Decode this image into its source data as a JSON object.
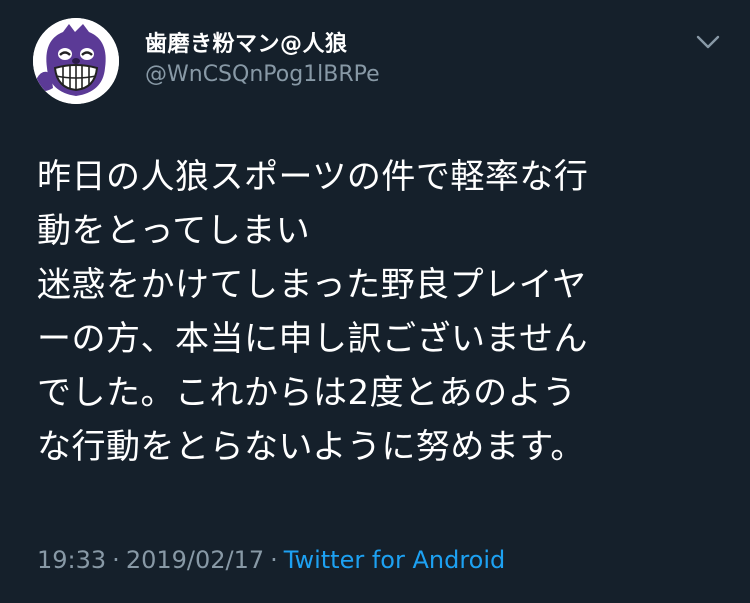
{
  "header": {
    "display_name": "歯磨き粉マン@人狼",
    "handle": "@WnCSQnPog1lBRPe"
  },
  "icons": {
    "avatar": "toothpaste-mascot-avatar",
    "menu": "chevron-down-icon"
  },
  "tweet": {
    "lines": [
      "昨日の人狼スポーツの件で軽率な行",
      "動をとってしまい",
      "迷惑をかけてしまった野良プレイヤ",
      "ーの方、本当に申し訳ございません",
      "でした。これからは2度とあのよう",
      "な行動をとらないように努めます。"
    ]
  },
  "meta": {
    "time": "19:33",
    "separator": "·",
    "date": "2019/02/17",
    "source": "Twitter for Android"
  },
  "colors": {
    "background": "#15202b",
    "text": "#ffffff",
    "secondary": "#8899a6",
    "link": "#1da1f2"
  }
}
